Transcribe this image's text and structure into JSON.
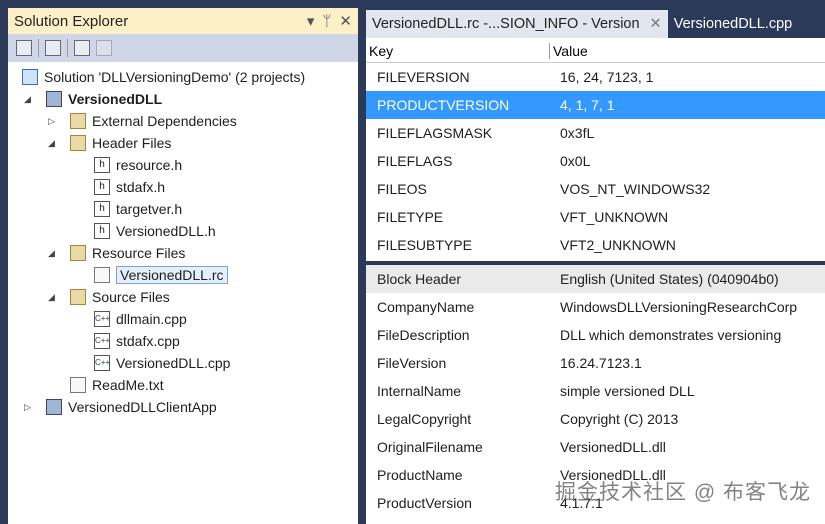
{
  "solution_explorer": {
    "title": "Solution Explorer",
    "dropdown_icon": "▾",
    "pin_icon": "ᛘ",
    "close_icon": "✕",
    "tree": [
      {
        "label": "Solution 'DLLVersioningDemo' (2 projects)",
        "icon": "solution",
        "level": 0
      },
      {
        "label": "VersionedDLL",
        "icon": "project",
        "level": 1,
        "expanded": true,
        "bold": true
      },
      {
        "label": "External Dependencies",
        "icon": "folder",
        "level": 2,
        "expanded": false
      },
      {
        "label": "Header Files",
        "icon": "folder",
        "level": 2,
        "expanded": true
      },
      {
        "label": "resource.h",
        "icon": "h",
        "level": 3
      },
      {
        "label": "stdafx.h",
        "icon": "h",
        "level": 3
      },
      {
        "label": "targetver.h",
        "icon": "h",
        "level": 3
      },
      {
        "label": "VersionedDLL.h",
        "icon": "h",
        "level": 3
      },
      {
        "label": "Resource Files",
        "icon": "folder",
        "level": 2,
        "expanded": true
      },
      {
        "label": "VersionedDLL.rc",
        "icon": "rc",
        "level": 3,
        "selected": true
      },
      {
        "label": "Source Files",
        "icon": "folder",
        "level": 2,
        "expanded": true
      },
      {
        "label": "dllmain.cpp",
        "icon": "cpp",
        "level": 3
      },
      {
        "label": "stdafx.cpp",
        "icon": "cpp",
        "level": 3
      },
      {
        "label": "VersionedDLL.cpp",
        "icon": "cpp",
        "level": 3
      },
      {
        "label": "ReadMe.txt",
        "icon": "txt",
        "level": 2
      },
      {
        "label": "VersionedDLLClientApp",
        "icon": "project",
        "level": 1,
        "expanded": false
      }
    ]
  },
  "tabs": [
    {
      "label": "VersionedDLL.rc -...SION_INFO - Version",
      "active": true
    },
    {
      "label": "VersionedDLL.cpp",
      "active": false
    }
  ],
  "tab_close": "✕",
  "columns": {
    "key": "Key",
    "value": "Value"
  },
  "fixed_rows": [
    {
      "key": "FILEVERSION",
      "value": "16, 24, 7123, 1"
    },
    {
      "key": "PRODUCTVERSION",
      "value": "4, 1, 7, 1",
      "selected": true
    },
    {
      "key": "FILEFLAGSMASK",
      "value": "0x3fL"
    },
    {
      "key": "FILEFLAGS",
      "value": "0x0L"
    },
    {
      "key": "FILEOS",
      "value": "VOS_NT_WINDOWS32"
    },
    {
      "key": "FILETYPE",
      "value": "VFT_UNKNOWN"
    },
    {
      "key": "FILESUBTYPE",
      "value": "VFT2_UNKNOWN"
    }
  ],
  "block_rows": [
    {
      "key": "Block Header",
      "value": "English (United States) (040904b0)"
    },
    {
      "key": "CompanyName",
      "value": "WindowsDLLVersioningResearchCorp"
    },
    {
      "key": "FileDescription",
      "value": "DLL which demonstrates versioning"
    },
    {
      "key": "FileVersion",
      "value": "16.24.7123.1"
    },
    {
      "key": "InternalName",
      "value": "simple versioned DLL"
    },
    {
      "key": "LegalCopyright",
      "value": "Copyright (C) 2013"
    },
    {
      "key": "OriginalFilename",
      "value": "VersionedDLL.dll"
    },
    {
      "key": "ProductName",
      "value": "VersionedDLL.dll"
    },
    {
      "key": "ProductVersion",
      "value": "4.1.7.1"
    }
  ],
  "watermark": "掘金技术社区 @ 布客飞龙"
}
